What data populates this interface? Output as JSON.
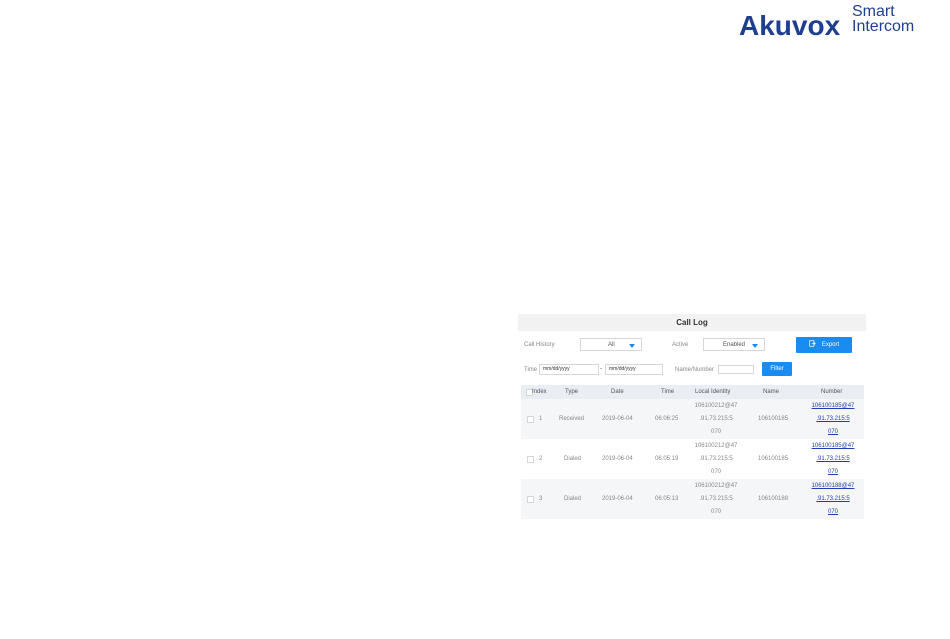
{
  "brand": {
    "name": "Akuvox",
    "tagline_line1": "Smart",
    "tagline_line2": "Intercom"
  },
  "call_log": {
    "title": "Call Log",
    "call_history_label": "Call History",
    "call_history_value": "All",
    "active_label": "Active",
    "active_value": "Enabled",
    "export_label": "Export",
    "time_label": "Time",
    "date_from_placeholder": "mm/dd/yyyy",
    "date_separator": "-",
    "date_to_placeholder": "mm/dd/yyyy",
    "name_number_label": "Name/Number",
    "filter_label": "Filter",
    "columns": [
      "Index",
      "Type",
      "Date",
      "Time",
      "Local Identity",
      "Name",
      "Number"
    ],
    "rows": [
      {
        "index": "1",
        "type": "Received",
        "date": "2019-06-04",
        "time": "06:06:25",
        "local_identity": [
          "106100212@47",
          ".91.73.215:5",
          "070"
        ],
        "name": "106100185",
        "number": [
          "106100185@47",
          ".91.73.215:5",
          "070"
        ]
      },
      {
        "index": "2",
        "type": "Dialed",
        "date": "2019-06-04",
        "time": "06:05:19",
        "local_identity": [
          "106100212@47",
          ".91.73.215:5",
          "070"
        ],
        "name": "106100185",
        "number": [
          "106100185@47",
          ".91.73.215:5",
          "070"
        ]
      },
      {
        "index": "3",
        "type": "Dialed",
        "date": "2019-06-04",
        "time": "06:05:13",
        "local_identity": [
          "106100212@47",
          ".91.73.215:5",
          "070"
        ],
        "name": "106100188",
        "number": [
          "106100188@47",
          ".91.73.215:5",
          "070"
        ]
      }
    ]
  },
  "colors": {
    "brand": "#1e3f8f",
    "accent": "#1a8cf0",
    "link": "#1f3fb5"
  }
}
